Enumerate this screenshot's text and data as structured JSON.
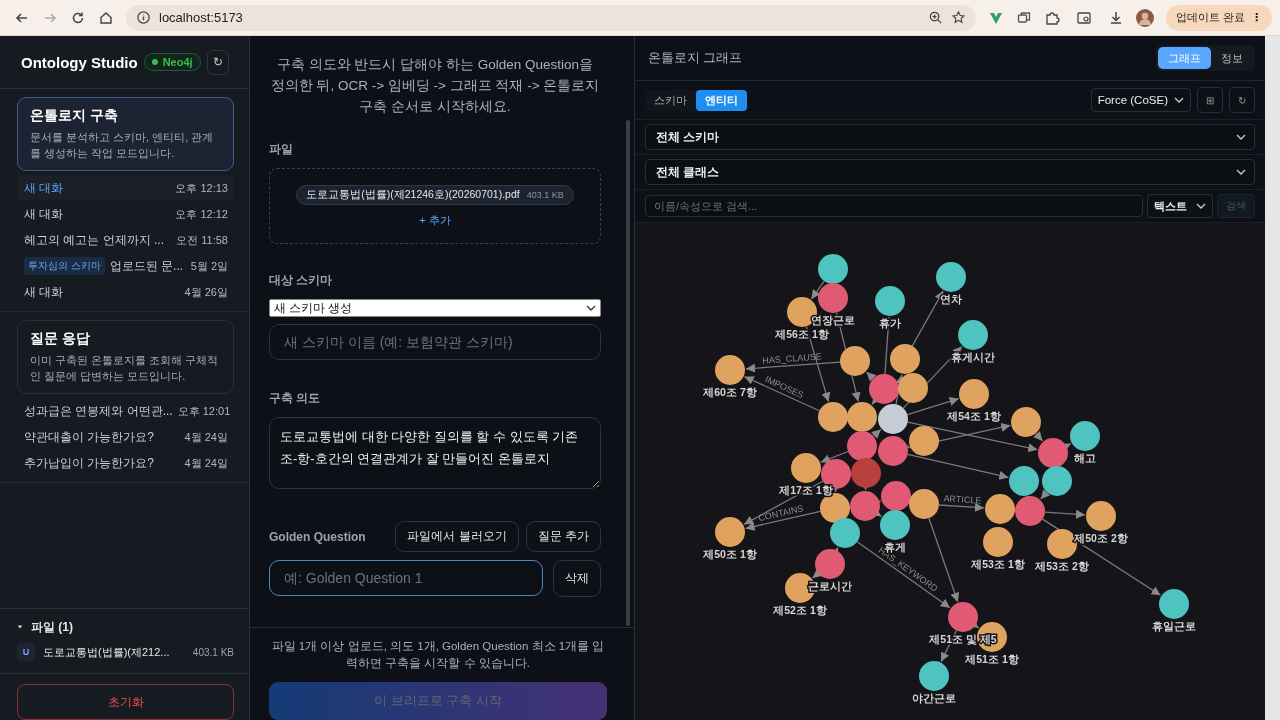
{
  "browser": {
    "url": "localhost:5173",
    "update_button": "업데이트 완료",
    "menu_glyph": "⋮"
  },
  "sidebar": {
    "app_title": "Ontology Studio",
    "db_badge": "Neo4j",
    "db_connected": true,
    "refresh_glyph": "↻",
    "modes": [
      {
        "title": "온톨로지 구축",
        "description": "문서를 분석하고 스키마, 엔티티, 관계를 생성하는 작업 모드입니다.",
        "selected": true,
        "conversations": [
          {
            "title": "새 대화",
            "time": "오후 12:13",
            "selected": true
          },
          {
            "title": "새 대화",
            "time": "오후 12:12",
            "selected": false
          },
          {
            "title": "헤고의 예고는 언제까지 ...",
            "time": "오전 11:58",
            "selected": false
          },
          {
            "tag": "투자심의 스키마",
            "title": "업로드된 문...",
            "time": "5월 2일",
            "selected": false
          },
          {
            "title": "새 대화",
            "time": "4월 26일",
            "selected": false
          }
        ]
      },
      {
        "title": "질문 응답",
        "description": "이미 구축된 온톨로지를 조회해 구체적인 질문에 답변하는 모드입니다.",
        "selected": false,
        "conversations": [
          {
            "title": "성과급은 연봉제와 어떤관...",
            "time": "오후 12:01",
            "selected": false
          },
          {
            "title": "약관대출이 가능한가요?",
            "time": "4월 24일",
            "selected": false
          },
          {
            "title": "추가납입이 가능한가요?",
            "time": "4월 24일",
            "selected": false
          }
        ]
      }
    ],
    "files": {
      "heading": "파일 (1)",
      "expanded": true,
      "items": [
        {
          "badge": "U",
          "name": "도로교통법(법률)(제212...",
          "size": "403.1 KB"
        }
      ]
    },
    "reset_button": "초기화"
  },
  "brief": {
    "intro": "구축 의도와 반드시 답해야 하는 Golden Question을 정의한 뒤, OCR -> 임베딩 -> 그래프 적재 -> 온톨로지 구축 순서로 시작하세요.",
    "file_label": "파일",
    "file_chip": {
      "name": "도로교통법(법률)(제21246호)(20260701).pdf",
      "size": "403.1 KB"
    },
    "add_link": "+ 추가",
    "schema_label": "대상 스키마",
    "schema_select": "새 스키마 생성",
    "schema_name_placeholder": "새 스키마 이름 (예: 보험약관 스키마)",
    "intent_label": "구축 의도",
    "intent_value": "도로교통법에 대한 다양한 질의를 할 수 있도록 기존 조-항-호간의 연결관계가 잘 만들어진 온톨로지",
    "golden_label": "Golden Question",
    "load_button": "파일에서 불러오기",
    "add_button": "질문 추가",
    "question_placeholder": "예: Golden Question 1",
    "delete_button": "삭제",
    "hint": "파일 1개 이상 업로드, 의도 1개, Golden Question 최소 1개를 입력하면 구축을 시작할 수 있습니다.",
    "start_button": "이 브리프로 구축 시작",
    "start_disabled": true
  },
  "graph_panel": {
    "title": "온톨로지 그래프",
    "view_tabs": [
      {
        "label": "그래프",
        "selected": true
      },
      {
        "label": "정보",
        "selected": false
      }
    ],
    "mode_tabs": [
      {
        "label": "스키마",
        "selected": false
      },
      {
        "label": "엔티티",
        "selected": true
      }
    ],
    "layout_select": "Force (CoSE)",
    "fit_glyph": "⊞",
    "refresh_glyph": "↻",
    "schema_filter": "전체 스키마",
    "class_filter": "전체 클래스",
    "search_placeholder": "이름/속성으로 검색...",
    "search_type": "텍스트",
    "search_button": "검색",
    "search_disabled": true,
    "nodes": [
      {
        "color": "#4fc3bf"
      },
      {
        "color": "#e05a74",
        "label": "연장근로"
      },
      {
        "color": "#dfa35f",
        "label": "제56조 1항"
      },
      {
        "color": "#4fc3bf",
        "label": "휴가"
      },
      {
        "color": "#4fc3bf",
        "label": "연차"
      },
      {
        "color": "#4fc3bf",
        "label": "휴게시간"
      },
      {
        "color": "#dfa35f",
        "label": "제60조 7항"
      },
      {
        "color": "#dfa35f"
      },
      {
        "color": "#dfa35f"
      },
      {
        "color": "#e05a74"
      },
      {
        "color": "#dfa35f"
      },
      {
        "color": "#dfa35f",
        "label": "제54조 1항"
      },
      {
        "color": "#c5ccd6"
      },
      {
        "color": "#dfa35f"
      },
      {
        "color": "#dfa35f"
      },
      {
        "color": "#dfa35f"
      },
      {
        "color": "#e05a74"
      },
      {
        "color": "#4fc3bf",
        "label": "해고"
      },
      {
        "color": "#e05a74"
      },
      {
        "color": "#e05a74"
      },
      {
        "color": "#dfa35f"
      },
      {
        "color": "#dfa35f",
        "label": "제17조 1항"
      },
      {
        "color": "#e05a74"
      },
      {
        "color": "#b8413f"
      },
      {
        "color": "#4fc3bf"
      },
      {
        "color": "#4fc3bf"
      },
      {
        "color": "#e05a74"
      },
      {
        "color": "#e05a74"
      },
      {
        "color": "#dfa35f"
      },
      {
        "color": "#dfa35f"
      },
      {
        "color": "#4fc3bf"
      },
      {
        "color": "#4fc3bf",
        "label": "휴게"
      },
      {
        "color": "#dfa35f"
      },
      {
        "color": "#e05a74"
      },
      {
        "color": "#dfa35f",
        "label": "제50조 2항"
      },
      {
        "color": "#dfa35f",
        "label": "제53조 1항"
      },
      {
        "color": "#dfa35f",
        "label": "제53조 2항"
      },
      {
        "color": "#dfa35f",
        "label": "제50조 1항"
      },
      {
        "color": "#e05a74",
        "label": "근로시간"
      },
      {
        "color": "#dfa35f",
        "label": "제52조 1항"
      },
      {
        "color": "#e05a74",
        "label": "제51조 및 제5"
      },
      {
        "color": "#dfa35f",
        "label": "제51조 1항"
      },
      {
        "color": "#4fc3bf",
        "label": "야간근로"
      },
      {
        "color": "#4fc3bf",
        "label": "휴일근로"
      }
    ],
    "edge_labels": [
      {
        "label": "HAS_CLAUSE"
      },
      {
        "label": "IMPOSES"
      },
      {
        "label": "CONTAINS"
      },
      {
        "label": "HAS_KEYWORD"
      },
      {
        "label": "ARTICLE"
      }
    ]
  }
}
